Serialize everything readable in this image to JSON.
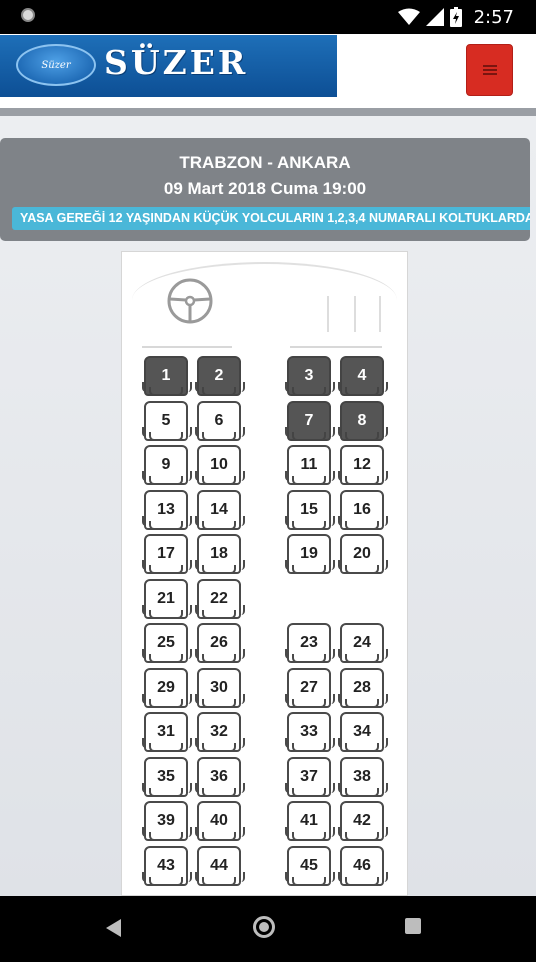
{
  "status_bar": {
    "time": "2:57",
    "icons": [
      "notification-dot-icon",
      "wifi-icon",
      "signal-icon",
      "battery-charging-icon"
    ]
  },
  "header": {
    "logo_small_text": "Süzer",
    "brand_name": "SÜZER",
    "menu_icon": "hamburger-menu-icon"
  },
  "trip": {
    "route": "TRABZON - ANKARA",
    "datetime": "09 Mart 2018 Cuma 19:00",
    "notice": "YASA GEREĞİ 12 YAŞINDAN KÜÇÜK YOLCULARIN 1,2,3,4 NUMARALI KOLTUKLARDA"
  },
  "bus": {
    "icons": [
      "steering-wheel-icon",
      "door-icon"
    ],
    "seats": [
      {
        "number": "1",
        "taken": true
      },
      {
        "number": "2",
        "taken": true
      },
      {
        "number": "3",
        "taken": true
      },
      {
        "number": "4",
        "taken": true
      },
      {
        "number": "5",
        "taken": false
      },
      {
        "number": "6",
        "taken": false
      },
      {
        "number": "7",
        "taken": true
      },
      {
        "number": "8",
        "taken": true
      },
      {
        "number": "9",
        "taken": false
      },
      {
        "number": "10",
        "taken": false
      },
      {
        "number": "11",
        "taken": false
      },
      {
        "number": "12",
        "taken": false
      },
      {
        "number": "13",
        "taken": false
      },
      {
        "number": "14",
        "taken": false
      },
      {
        "number": "15",
        "taken": false
      },
      {
        "number": "16",
        "taken": false
      },
      {
        "number": "17",
        "taken": false
      },
      {
        "number": "18",
        "taken": false
      },
      {
        "number": "19",
        "taken": false
      },
      {
        "number": "20",
        "taken": false
      },
      {
        "number": "21",
        "taken": false
      },
      {
        "number": "22",
        "taken": false
      },
      {
        "number": "25",
        "taken": false
      },
      {
        "number": "26",
        "taken": false
      },
      {
        "number": "23",
        "taken": false
      },
      {
        "number": "24",
        "taken": false
      },
      {
        "number": "29",
        "taken": false
      },
      {
        "number": "30",
        "taken": false
      },
      {
        "number": "27",
        "taken": false
      },
      {
        "number": "28",
        "taken": false
      },
      {
        "number": "31",
        "taken": false
      },
      {
        "number": "32",
        "taken": false
      },
      {
        "number": "33",
        "taken": false
      },
      {
        "number": "34",
        "taken": false
      },
      {
        "number": "35",
        "taken": false
      },
      {
        "number": "36",
        "taken": false
      },
      {
        "number": "37",
        "taken": false
      },
      {
        "number": "38",
        "taken": false
      },
      {
        "number": "39",
        "taken": false
      },
      {
        "number": "40",
        "taken": false
      },
      {
        "number": "41",
        "taken": false
      },
      {
        "number": "42",
        "taken": false
      },
      {
        "number": "43",
        "taken": false
      },
      {
        "number": "44",
        "taken": false
      },
      {
        "number": "45",
        "taken": false
      },
      {
        "number": "46",
        "taken": false
      }
    ]
  },
  "nav_bar": {
    "icons": [
      "back-icon",
      "home-icon",
      "recent-apps-icon"
    ]
  }
}
